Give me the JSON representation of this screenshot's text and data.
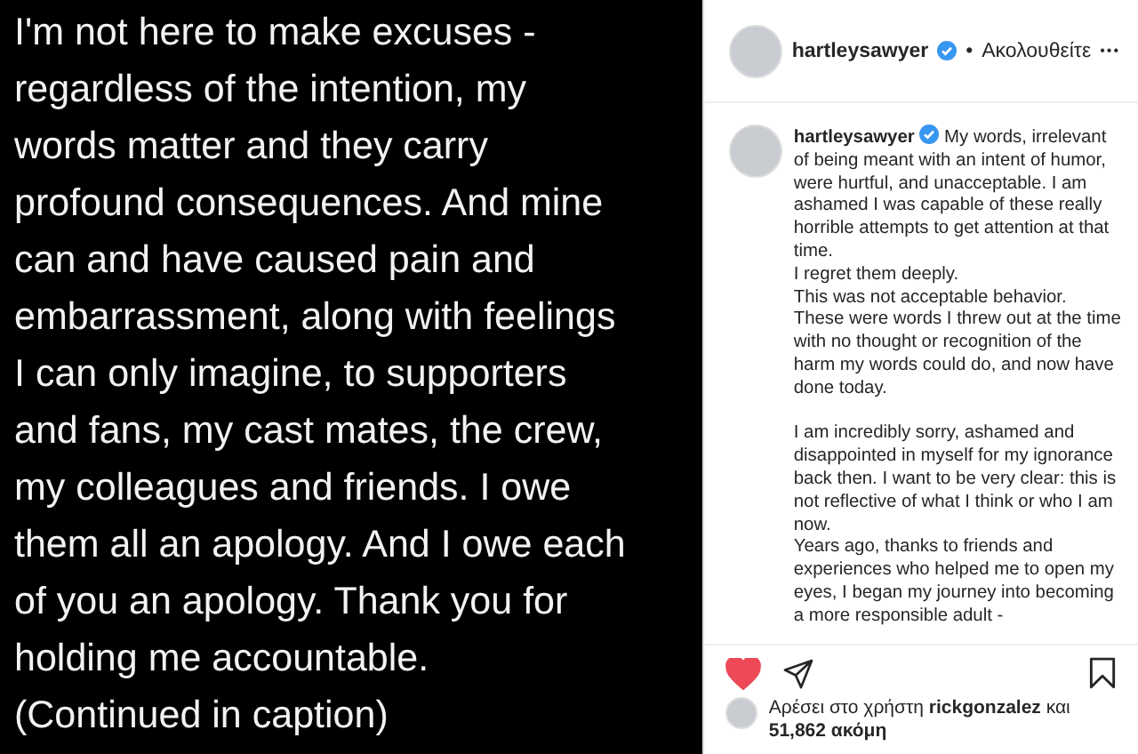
{
  "post_image": {
    "lines": [
      "I'm not here to make excuses -",
      "regardless of the intention, my",
      "words matter and they carry",
      "profound consequences. And mine",
      "can and have caused pain and",
      "embarrassment, along with feelings",
      "I can only imagine, to supporters",
      "and fans, my cast mates, the crew,",
      "my colleagues and friends. I owe",
      "them all an apology. And I owe each",
      "of you an apology. Thank you for",
      "holding me accountable.",
      "(Continued in caption)"
    ]
  },
  "header": {
    "username": "hartleysawyer",
    "verified": true,
    "separator": "•",
    "follow_status": "Ακολουθείτε",
    "more": "•••"
  },
  "caption": {
    "username": "hartleysawyer",
    "verified": true,
    "paragraphs": [
      [
        "My words, irrelevant of being meant with an intent of humor, were hurtful, and unacceptable. I am ashamed I was capable of these really horrible attempts to get attention at that time.",
        "I regret them deeply.",
        "This was not acceptable behavior.",
        "These were words I threw out at the time with no thought or recognition of the harm my words could do, and now have done today."
      ],
      [
        "I am incredibly sorry, ashamed and disappointed in myself for my ignorance back then. I want to be very clear: this is not reflective of what I think or who I am now.",
        "Years ago, thanks to friends and experiences who helped me to open my eyes, I began my journey into becoming a more responsible adult -"
      ]
    ]
  },
  "actions": {
    "liked": true
  },
  "likes": {
    "prefix": "Αρέσει στο χρήστη",
    "user": "rickgonzalez",
    "suffix": "και",
    "count": "51,862 ακόμη"
  }
}
